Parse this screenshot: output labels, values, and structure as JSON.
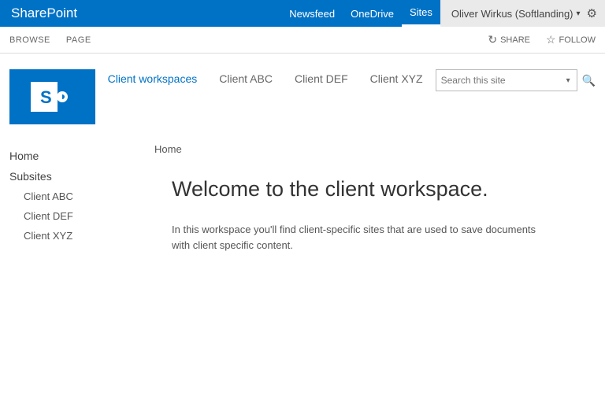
{
  "suite": {
    "brand": "SharePoint",
    "links": [
      "Newsfeed",
      "OneDrive",
      "Sites"
    ],
    "active_index": 2,
    "user": "Oliver Wirkus (Softlanding)"
  },
  "ribbon": {
    "tabs": [
      "BROWSE",
      "PAGE"
    ],
    "share_label": "SHARE",
    "follow_label": "FOLLOW"
  },
  "topnav": {
    "items": [
      "Client workspaces",
      "Client ABC",
      "Client DEF",
      "Client XYZ"
    ],
    "current_index": 0
  },
  "search": {
    "placeholder": "Search this site"
  },
  "leftnav": {
    "home": "Home",
    "subsites_label": "Subsites",
    "subsites": [
      "Client ABC",
      "Client DEF",
      "Client XYZ"
    ]
  },
  "content": {
    "breadcrumb": "Home",
    "title": "Welcome to the client workspace.",
    "body": "In this workspace you'll find client-specific sites that are used to save documents with client specific content."
  }
}
